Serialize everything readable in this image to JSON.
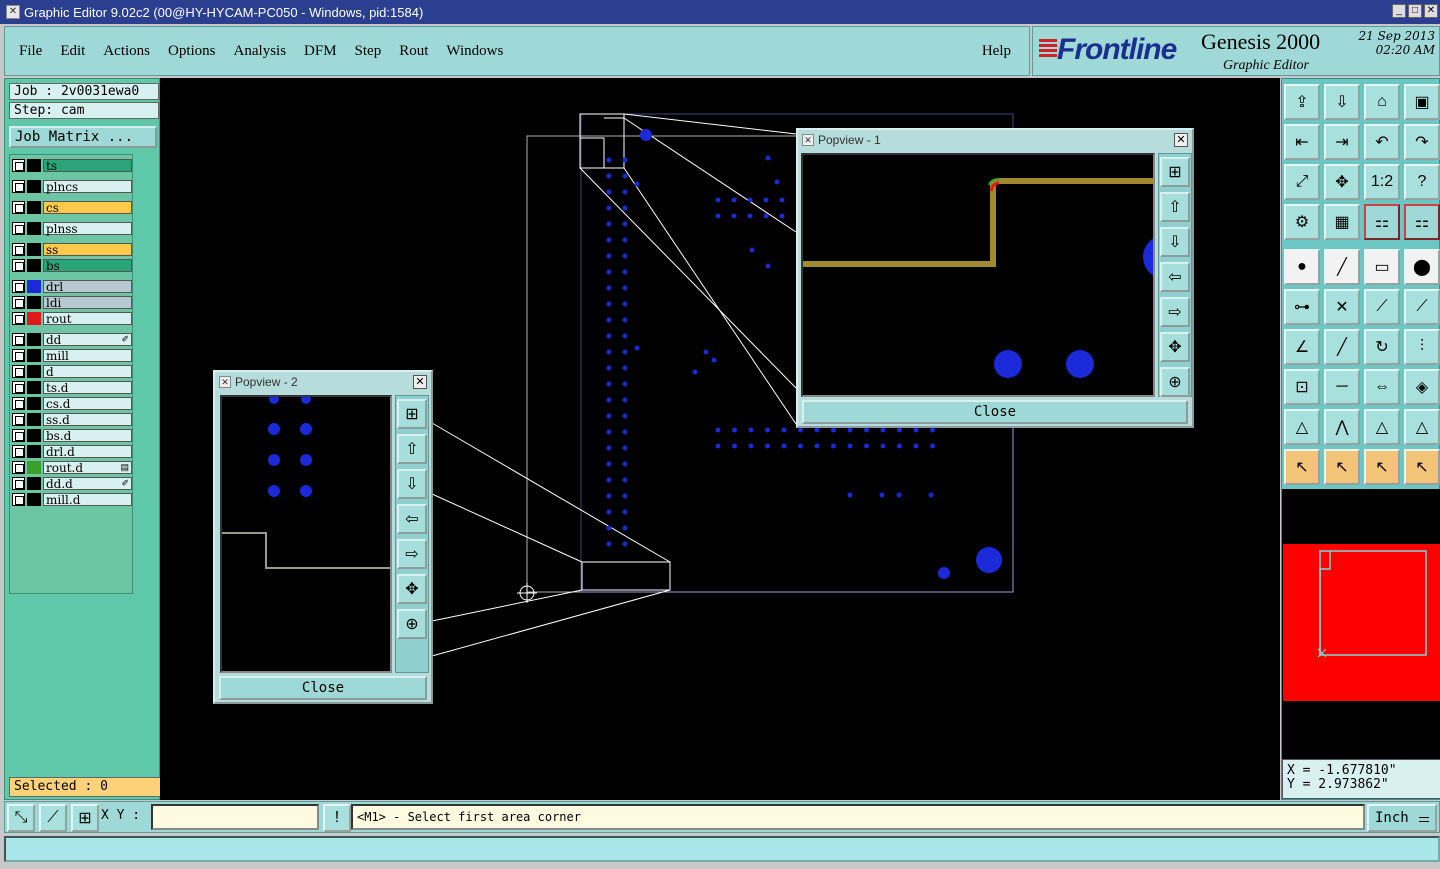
{
  "window": {
    "title": "Graphic Editor 9.02c2 (00@HY-HYCAM-PC050 - Windows, pid:1584)"
  },
  "menubar": {
    "items": [
      "File",
      "Edit",
      "Actions",
      "Options",
      "Analysis",
      "DFM",
      "Step",
      "Rout",
      "Windows"
    ],
    "help": "Help"
  },
  "brand": {
    "logo": "Frontline",
    "product": "Genesis 2000",
    "subtitle": "Graphic Editor",
    "date": "21 Sep 2013",
    "time": "02:20 AM"
  },
  "job": {
    "job_line": "Job : 2v0031ewa0",
    "step_line": "Step: cam",
    "matrix_button": "Job Matrix ..."
  },
  "layers": [
    {
      "name": "ts",
      "swatch": "#000000",
      "fill": "#2aa57a"
    },
    {
      "name": "plncs",
      "swatch": "#000000",
      "fill": "#d8f0ef"
    },
    {
      "name": "cs",
      "swatch": "#000000",
      "fill": "#ffc94a"
    },
    {
      "name": "plnss",
      "swatch": "#000000",
      "fill": "#d8f0ef"
    },
    {
      "name": "ss",
      "swatch": "#000000",
      "fill": "#ffc94a"
    },
    {
      "name": "bs",
      "swatch": "#000000",
      "fill": "#2aa57a"
    },
    {
      "name": "drl",
      "swatch": "#1a2ad8",
      "fill": "#b8c8d0"
    },
    {
      "name": "ldi",
      "swatch": "#000000",
      "fill": "#b8c8d0"
    },
    {
      "name": "rout",
      "swatch": "#e01818",
      "fill": "#d8f0ef"
    },
    {
      "name": "dd",
      "swatch": "#000000",
      "fill": "#d8f0ef",
      "mark": "✐"
    },
    {
      "name": "mill",
      "swatch": "#000000",
      "fill": "#d8f0ef"
    },
    {
      "name": "d",
      "swatch": "#000000",
      "fill": "#d8f0ef"
    },
    {
      "name": "ts.d",
      "swatch": "#000000",
      "fill": "#d8f0ef"
    },
    {
      "name": "cs.d",
      "swatch": "#000000",
      "fill": "#d8f0ef"
    },
    {
      "name": "ss.d",
      "swatch": "#000000",
      "fill": "#d8f0ef"
    },
    {
      "name": "bs.d",
      "swatch": "#000000",
      "fill": "#d8f0ef"
    },
    {
      "name": "drl.d",
      "swatch": "#000000",
      "fill": "#d8f0ef"
    },
    {
      "name": "rout.d",
      "swatch": "#3aa02a",
      "fill": "#d8f0ef",
      "mark": "▤"
    },
    {
      "name": "dd.d",
      "swatch": "#000000",
      "fill": "#d8f0ef",
      "mark": "✐"
    },
    {
      "name": "mill.d",
      "swatch": "#000000",
      "fill": "#d8f0ef"
    }
  ],
  "selected_text": "Selected : 0",
  "popview1": {
    "title": "Popview - 1",
    "close_label": "Close"
  },
  "popview2": {
    "title": "Popview - 2",
    "close_label": "Close"
  },
  "coords": {
    "x": "X = -1.677810\"",
    "y": "Y = 2.973862\""
  },
  "bottom": {
    "xy_label": "X Y :",
    "xy_value": "",
    "prompt": "<M1> - Select first area corner",
    "units": "Inch"
  },
  "colors": {
    "pad_blue": "#1a2ad8",
    "rout_red": "#ff0000",
    "trace_gold": "#a08a30",
    "profile_gray": "#b0b0b0"
  }
}
